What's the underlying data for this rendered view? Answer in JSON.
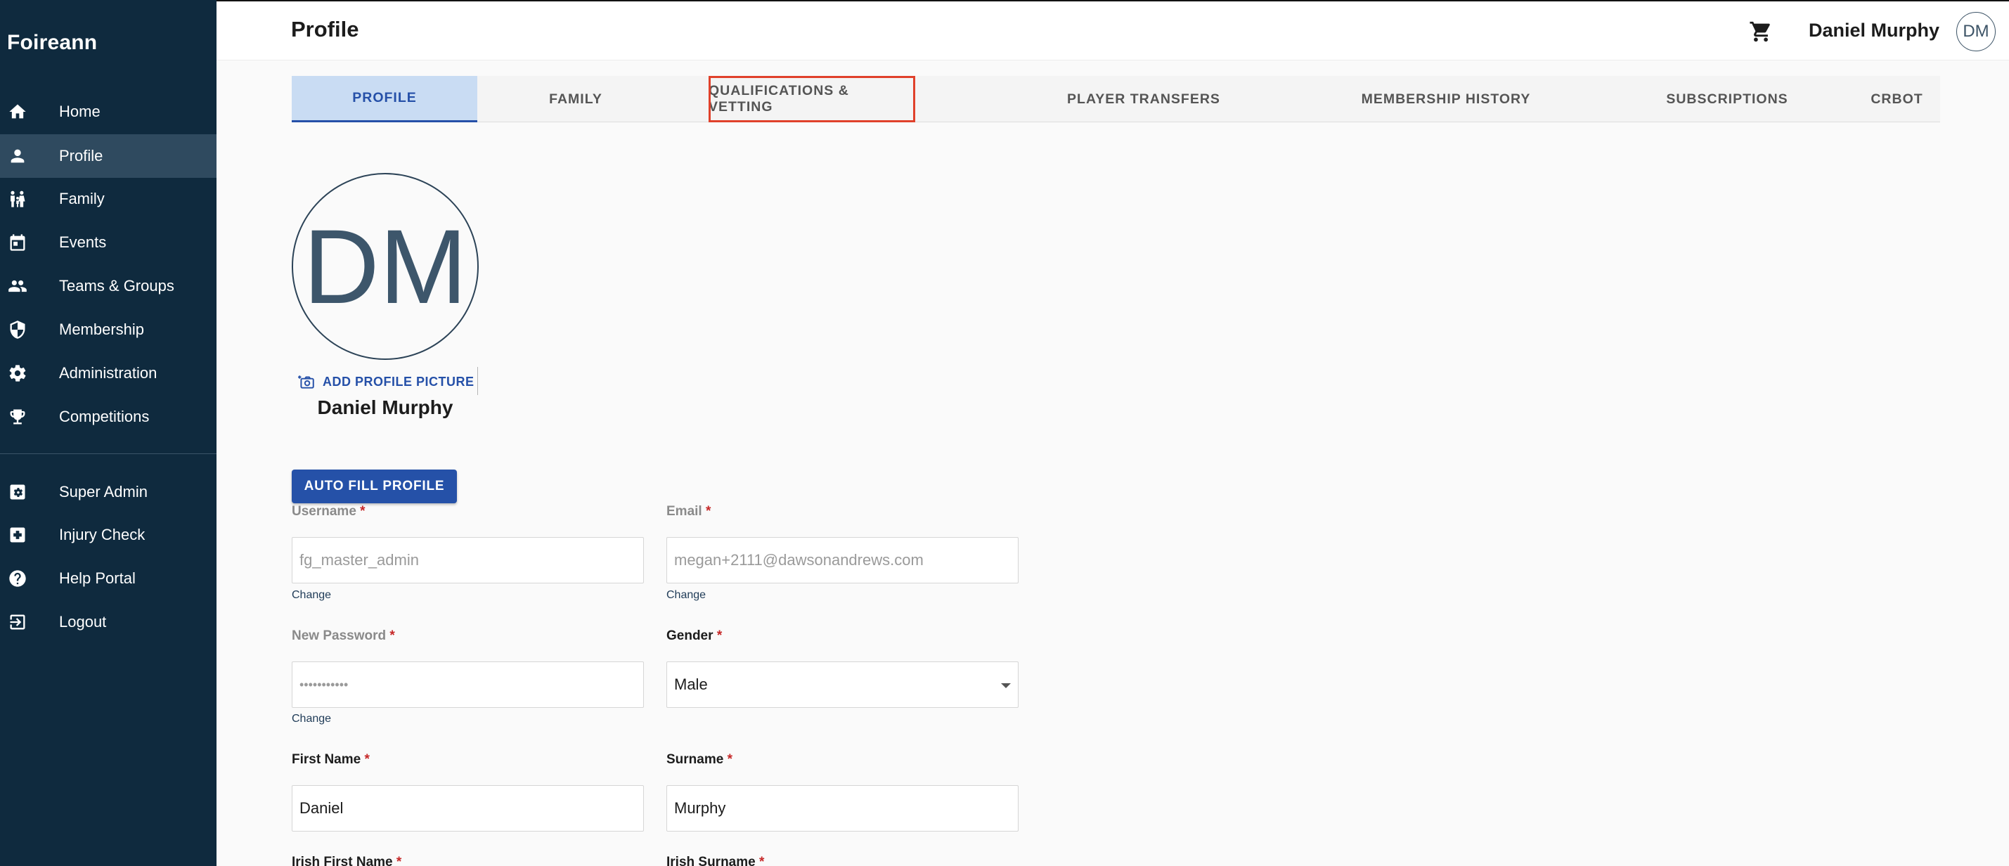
{
  "app": {
    "brand": "Foireann"
  },
  "sidebar": {
    "items": [
      {
        "label": "Home",
        "icon": "home-icon"
      },
      {
        "label": "Profile",
        "icon": "person-icon",
        "active": true
      },
      {
        "label": "Family",
        "icon": "family-icon"
      },
      {
        "label": "Events",
        "icon": "calendar-icon"
      },
      {
        "label": "Teams & Groups",
        "icon": "group-icon"
      },
      {
        "label": "Membership",
        "icon": "shield-icon"
      },
      {
        "label": "Administration",
        "icon": "gear-icon"
      },
      {
        "label": "Competitions",
        "icon": "trophy-icon"
      }
    ],
    "secondary": [
      {
        "label": "Super Admin",
        "icon": "admin-gear-icon"
      },
      {
        "label": "Injury Check",
        "icon": "medical-cross-icon"
      },
      {
        "label": "Help Portal",
        "icon": "help-icon"
      },
      {
        "label": "Logout",
        "icon": "logout-icon"
      }
    ]
  },
  "header": {
    "title": "Profile",
    "user_name": "Daniel Murphy",
    "avatar_initials": "DM"
  },
  "tabs": [
    {
      "label": "PROFILE",
      "active": true
    },
    {
      "label": "FAMILY"
    },
    {
      "label": "QUALIFICATIONS & VETTING",
      "highlighted": true
    },
    {
      "label": "PLAYER TRANSFERS"
    },
    {
      "label": "MEMBERSHIP HISTORY"
    },
    {
      "label": "SUBSCRIPTIONS"
    },
    {
      "label": "CRBOT"
    }
  ],
  "profile": {
    "avatar_initials": "DM",
    "add_picture_label": "ADD PROFILE PICTURE",
    "name": "Daniel Murphy",
    "autofill_label": "AUTO FILL PROFILE"
  },
  "form": {
    "required_mark": "*",
    "change_label": "Change",
    "username": {
      "label": "Username",
      "value": "fg_master_admin"
    },
    "email": {
      "label": "Email",
      "value": "megan+2111@dawsonandrews.com"
    },
    "new_password": {
      "label": "New Password",
      "value": "•••••••••••"
    },
    "gender": {
      "label": "Gender",
      "value": "Male"
    },
    "first_name": {
      "label": "First Name",
      "value": "Daniel"
    },
    "surname": {
      "label": "Surname",
      "value": "Murphy"
    },
    "irish_first_name": {
      "label": "Irish First Name"
    },
    "irish_surname": {
      "label": "Irish Surname"
    }
  },
  "colors": {
    "sidebar_bg": "#0f2a3e",
    "sidebar_active": "#2f4a5f",
    "accent": "#2551a8",
    "tab_active_bg": "#c9dcf3",
    "highlight_outline": "#e0412b",
    "required": "#c62828"
  }
}
